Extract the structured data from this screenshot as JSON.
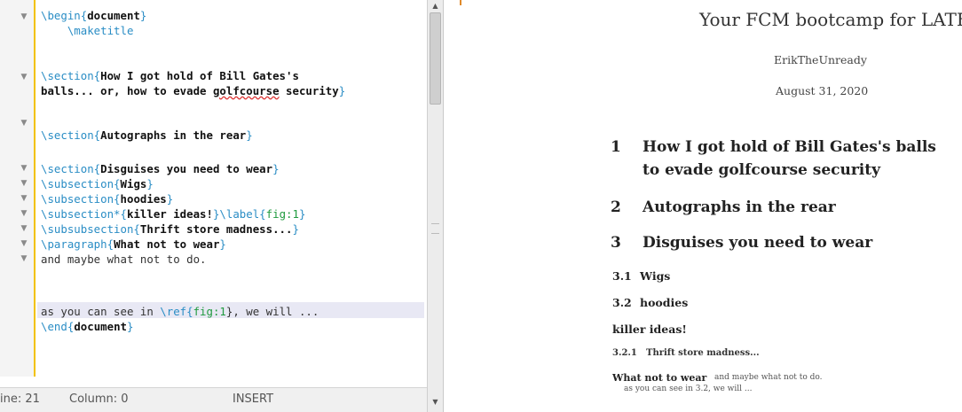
{
  "editor": {
    "lines": [
      {
        "parts": [
          {
            "t": "\\begin{",
            "c": "kw"
          },
          {
            "t": "document",
            "c": "arg"
          },
          {
            "t": "}",
            "c": "kw"
          }
        ]
      },
      {
        "parts": [
          {
            "t": "    \\maketitle",
            "c": "kw"
          }
        ]
      },
      {
        "parts": []
      },
      {
        "parts": [
          {
            "t": "\\section{",
            "c": "kw"
          },
          {
            "t": "How I got hold of Bill Gates's",
            "c": "arg"
          }
        ]
      },
      {
        "parts": [
          {
            "t": "balls... or, how to evade ",
            "c": "arg"
          },
          {
            "t": "golfcourse",
            "c": "arg squig"
          },
          {
            "t": " security",
            "c": "arg"
          },
          {
            "t": "}",
            "c": "kw"
          }
        ]
      },
      {
        "parts": []
      },
      {
        "parts": [
          {
            "t": "\\section{",
            "c": "kw"
          },
          {
            "t": "Autographs in the rear",
            "c": "arg"
          },
          {
            "t": "}",
            "c": "kw"
          }
        ]
      },
      {
        "parts": []
      },
      {
        "parts": [
          {
            "t": "\\section{",
            "c": "kw"
          },
          {
            "t": "Disguises you need to wear",
            "c": "arg"
          },
          {
            "t": "}",
            "c": "kw"
          }
        ]
      },
      {
        "parts": [
          {
            "t": "\\subsection{",
            "c": "kw"
          },
          {
            "t": "Wigs",
            "c": "arg"
          },
          {
            "t": "}",
            "c": "kw"
          }
        ]
      },
      {
        "parts": [
          {
            "t": "\\subsection{",
            "c": "kw"
          },
          {
            "t": "hoodies",
            "c": "arg"
          },
          {
            "t": "}",
            "c": "kw"
          }
        ]
      },
      {
        "parts": [
          {
            "t": "\\subsection*{",
            "c": "kw"
          },
          {
            "t": "killer ideas!",
            "c": "arg"
          },
          {
            "t": "}\\label{",
            "c": "kw"
          },
          {
            "t": "fig:1",
            "c": "lbl"
          },
          {
            "t": "}",
            "c": "kw"
          }
        ]
      },
      {
        "parts": [
          {
            "t": "\\subsubsection{",
            "c": "kw"
          },
          {
            "t": "Thrift store madness...",
            "c": "arg"
          },
          {
            "t": "}",
            "c": "kw"
          }
        ]
      },
      {
        "parts": [
          {
            "t": "\\paragraph{",
            "c": "kw"
          },
          {
            "t": "What not to wear",
            "c": "arg"
          },
          {
            "t": "}",
            "c": "kw"
          }
        ]
      },
      {
        "parts": [
          {
            "t": "and maybe what not to do.",
            "c": "plain"
          }
        ]
      },
      {
        "parts": []
      },
      {
        "parts": [
          {
            "t": "as you can see in ",
            "c": "plain"
          },
          {
            "t": "\\ref{",
            "c": "kw"
          },
          {
            "t": "fig:1",
            "c": "lbl"
          },
          {
            "t": "}, we will ...",
            "c": "plain"
          }
        ]
      },
      {
        "parts": [
          {
            "t": "\\end{",
            "c": "kw"
          },
          {
            "t": "document",
            "c": "arg"
          },
          {
            "t": "}",
            "c": "kw"
          }
        ]
      }
    ]
  },
  "status": {
    "line_text": "ine: 21",
    "column_text": "Column: 0",
    "mode": "INSERT"
  },
  "preview": {
    "title": "Your FCM bootcamp for LATEX",
    "author": "ErikTheUnready",
    "date": "August 31, 2020",
    "section1_num": "1",
    "section1_line1": "How I got hold of Bill Gates's balls",
    "section1_line2": "to evade golfcourse security",
    "section2_num": "2",
    "section2": "Autographs in the rear",
    "section3_num": "3",
    "section3": "Disguises you need to wear",
    "subsec1_num": "3.1",
    "subsec1": "Wigs",
    "subsec2_num": "3.2",
    "subsec2": "hoodies",
    "unnumbered": "killer ideas!",
    "subsub_num": "3.2.1",
    "subsub": "Thrift store madness...",
    "para_head": "What not to wear",
    "para_text": "and maybe what not to do.",
    "ref_text": "as you can see in 3.2, we will ..."
  },
  "colors": {
    "keyword": "#2a8dc5",
    "label": "#1f9a3e",
    "current_line": "#e8e8f4",
    "change_bar": "#f2c200"
  }
}
